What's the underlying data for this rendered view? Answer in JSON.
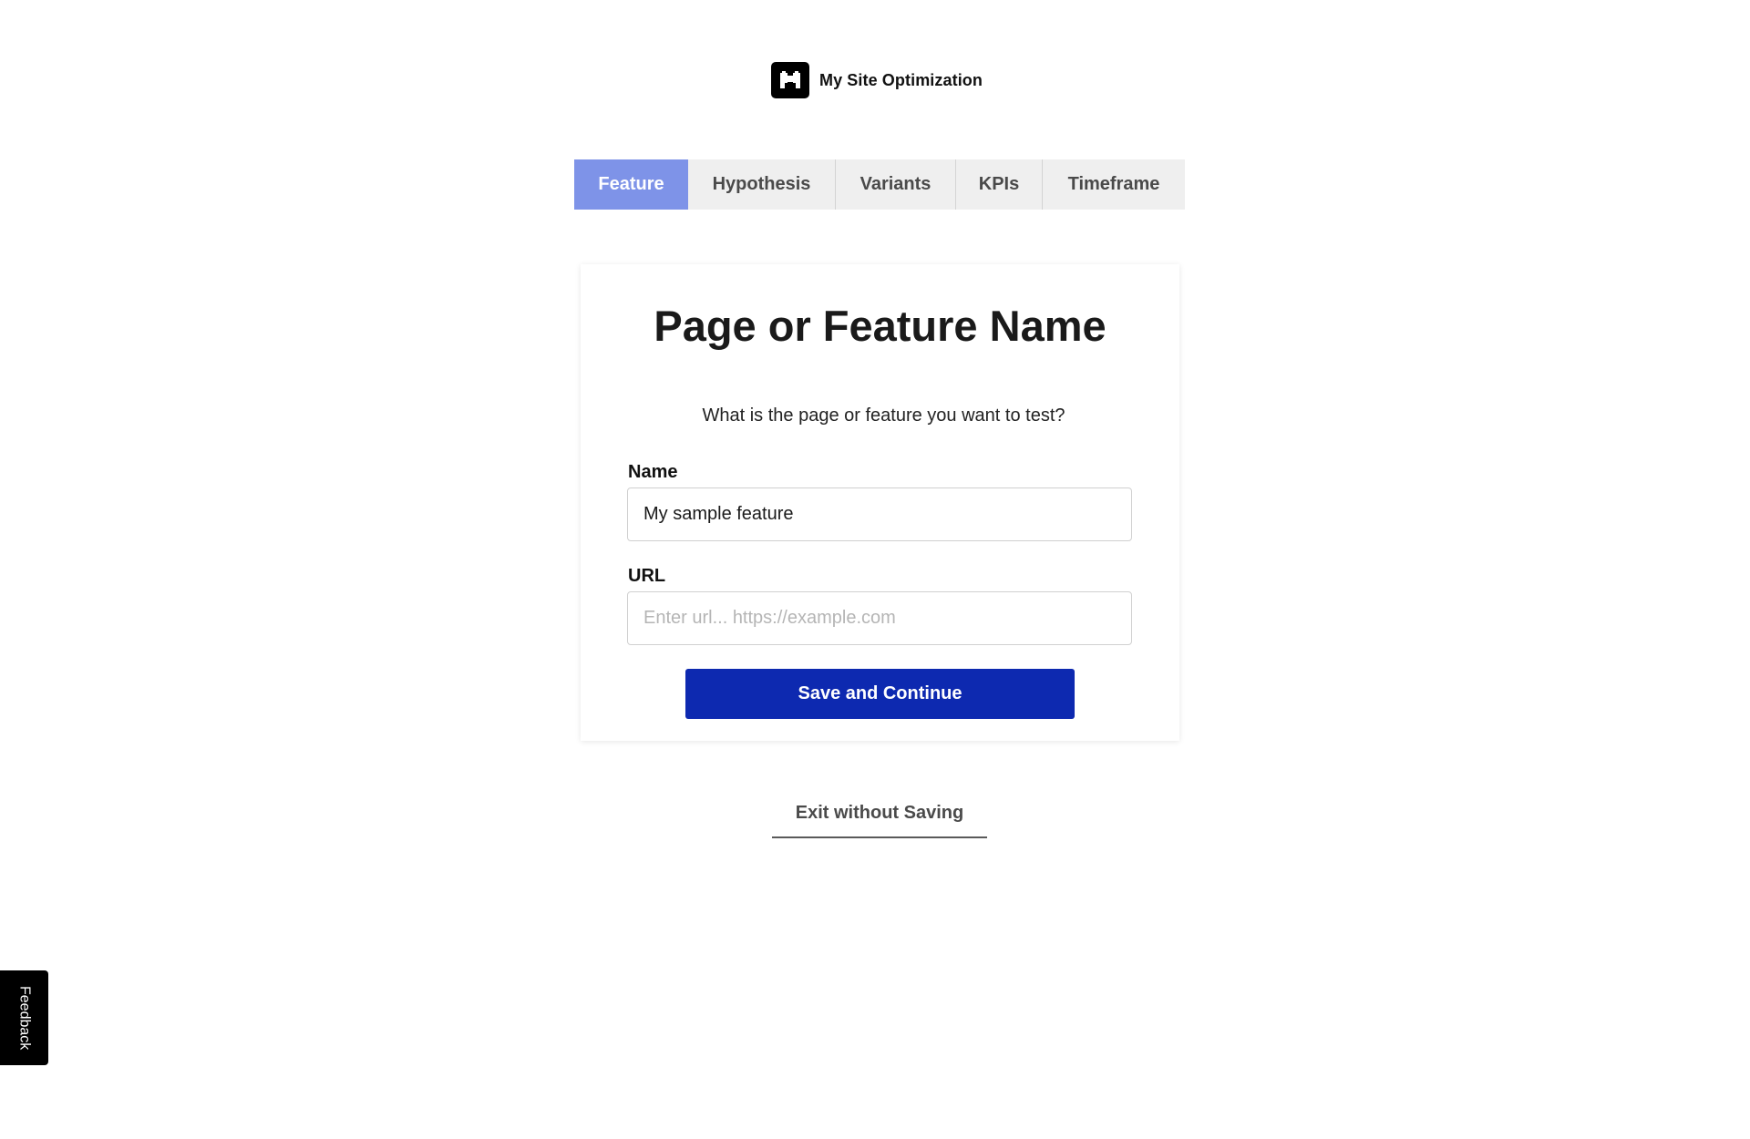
{
  "header": {
    "brand_name": "My Site Optimization",
    "logo_icon": "binoculars-logo-icon"
  },
  "tabs": [
    {
      "label": "Feature",
      "active": true
    },
    {
      "label": "Hypothesis",
      "active": false
    },
    {
      "label": "Variants",
      "active": false
    },
    {
      "label": "KPIs",
      "active": false
    },
    {
      "label": "Timeframe",
      "active": false
    }
  ],
  "card": {
    "title": "Page or Feature Name",
    "subtitle": "What is the page or feature you want to test?",
    "name_field": {
      "label": "Name",
      "value": "My sample feature",
      "placeholder": ""
    },
    "url_field": {
      "label": "URL",
      "value": "",
      "placeholder": "Enter url... https://example.com"
    },
    "save_label": "Save and Continue"
  },
  "exit_label": "Exit without Saving",
  "feedback_label": "Feedback",
  "colors": {
    "active_tab": "#7e93e8",
    "tab_background": "#efefef",
    "primary_button": "#0d29b0",
    "feedback_background": "#000000"
  }
}
